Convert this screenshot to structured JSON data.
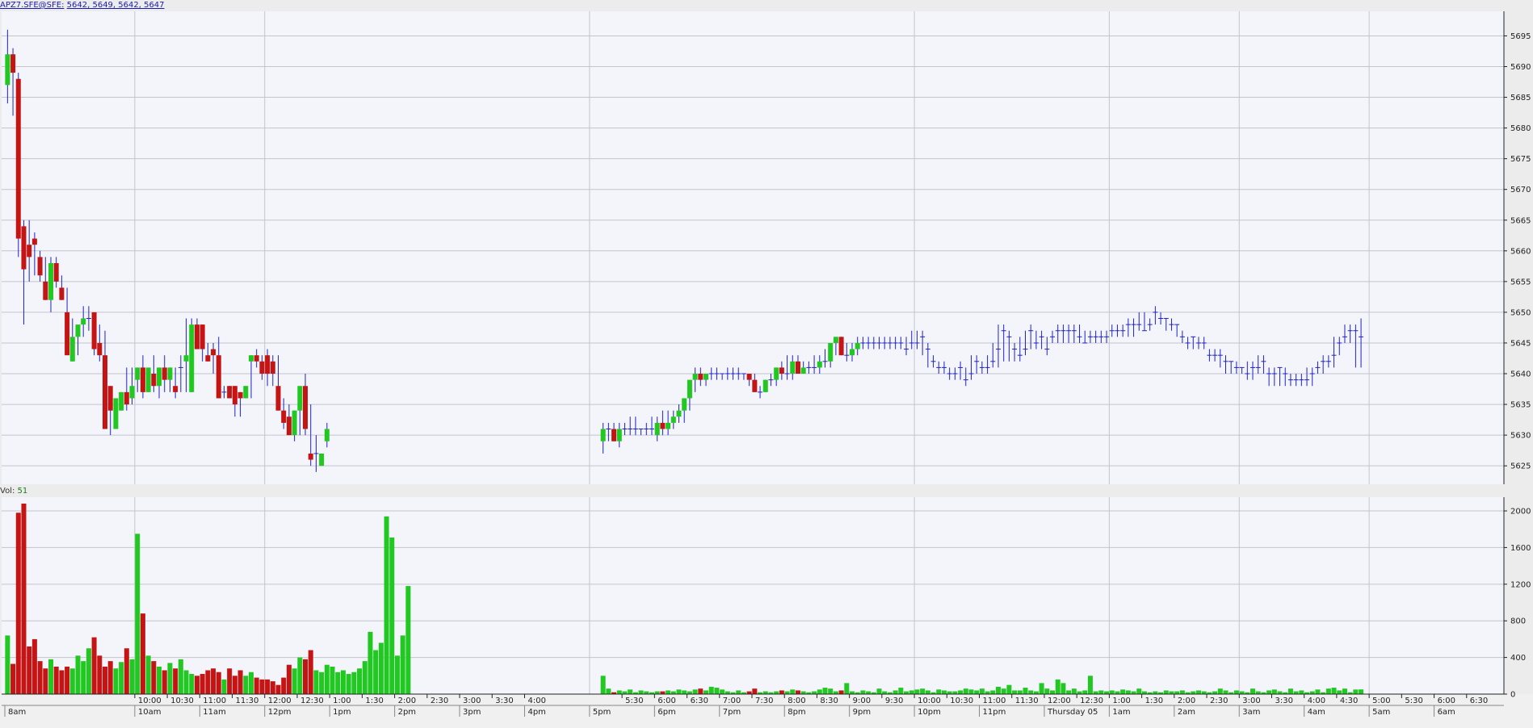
{
  "price_header": {
    "symbol": "APZ7.SFE@SFE:",
    "ohlc": "5642, 5649, 5642, 5647"
  },
  "volume_header": {
    "label": "Vol:",
    "value": "51"
  },
  "colors": {
    "up": "#22c822",
    "down": "#c41414",
    "doji": "#1e22c8",
    "grid": "#c4c4cc",
    "plot_bg": "#f4f4fb"
  },
  "chart_data": [
    {
      "type": "candlestick",
      "title": "APZ7.SFE@SFE",
      "interval_minutes": 5,
      "ylim": [
        5622,
        5699
      ],
      "yticks": [
        5625,
        5630,
        5635,
        5640,
        5645,
        5650,
        5655,
        5660,
        5665,
        5670,
        5675,
        5680,
        5685,
        5690,
        5695
      ],
      "grid": true,
      "legend": "none",
      "day_session": {
        "start_time": "8:00am",
        "end_time": "4:30pm",
        "open": [
          5687,
          5692,
          5688,
          5664,
          5661,
          5662,
          5659,
          5655,
          5652,
          5658,
          5654,
          5650,
          5642,
          5646,
          5648,
          5649,
          5650,
          5645,
          5643,
          5638,
          5631,
          5634,
          5637,
          5636,
          5639,
          5641,
          5637,
          5640,
          5638,
          5641,
          5639,
          5638,
          5641,
          5642,
          5637,
          5648,
          5648,
          5643,
          5644,
          5643,
          5637,
          5638,
          5638,
          5637,
          5636,
          5642,
          5643,
          5642,
          5643,
          5642,
          5638,
          5634,
          5633,
          5630,
          5634,
          5638,
          5627,
          5627,
          5625,
          5629
        ],
        "high": [
          5696,
          5693,
          5689,
          5665,
          5665,
          5663,
          5660,
          5659,
          5659,
          5659,
          5656,
          5654,
          5649,
          5647,
          5651,
          5651,
          5650,
          5648,
          5647,
          5638,
          5635,
          5637,
          5641,
          5641,
          5641,
          5643,
          5639,
          5643,
          5641,
          5643,
          5641,
          5641,
          5643,
          5649,
          5649,
          5649,
          5648,
          5645,
          5645,
          5646,
          5638,
          5638,
          5638,
          5637,
          5638,
          5643,
          5644,
          5643,
          5644,
          5643,
          5643,
          5636,
          5635,
          5634,
          5638,
          5640,
          5635,
          5630,
          5627,
          5632
        ],
        "low": [
          5684,
          5682,
          5659,
          5648,
          5655,
          5656,
          5655,
          5652,
          5650,
          5654,
          5652,
          5645,
          5642,
          5643,
          5646,
          5647,
          5643,
          5642,
          5636,
          5630,
          5631,
          5634,
          5634,
          5635,
          5637,
          5636,
          5637,
          5637,
          5636,
          5637,
          5637,
          5636,
          5637,
          5637,
          5637,
          5644,
          5642,
          5642,
          5640,
          5636,
          5636,
          5636,
          5633,
          5633,
          5636,
          5636,
          5641,
          5639,
          5638,
          5638,
          5634,
          5631,
          5630,
          5629,
          5630,
          5630,
          5625,
          5624,
          5625,
          5628
        ],
        "close": [
          5692,
          5689,
          5662,
          5657,
          5659,
          5661,
          5656,
          5652,
          5658,
          5655,
          5652,
          5643,
          5646,
          5648,
          5649,
          5649,
          5644,
          5643,
          5631,
          5634,
          5636,
          5637,
          5635,
          5638,
          5641,
          5637,
          5641,
          5638,
          5641,
          5639,
          5641,
          5637,
          5641,
          5643,
          5648,
          5644,
          5644,
          5642,
          5643,
          5636,
          5637,
          5636,
          5635,
          5636,
          5638,
          5643,
          5642,
          5640,
          5640,
          5640,
          5634,
          5632,
          5630,
          5634,
          5638,
          5631,
          5626,
          5627,
          5627,
          5631
        ]
      },
      "night_session": {
        "start_time": "5:10pm",
        "end_time": "6:55am",
        "open": [
          5629,
          5631,
          5631,
          5629,
          5631,
          5631,
          5631,
          5631,
          5631,
          5631,
          5630,
          5632,
          5631,
          5632,
          5633,
          5634,
          5636,
          5639,
          5640,
          5639,
          5640,
          5640,
          5640,
          5640,
          5640,
          5640,
          5640,
          5640,
          5639,
          5637,
          5637,
          5639,
          5639,
          5641,
          5640,
          5640,
          5642,
          5640,
          5641,
          5641,
          5641,
          5642,
          5642,
          5645,
          5646,
          5643,
          5643,
          5644,
          5645,
          5645,
          5645,
          5645,
          5645,
          5645,
          5645,
          5645,
          5644,
          5645,
          5645,
          5646,
          5644,
          5642,
          5641,
          5641,
          5640,
          5640,
          5641,
          5639,
          5640,
          5642,
          5641,
          5641,
          5642,
          5644,
          5647,
          5646,
          5644,
          5643,
          5644,
          5647,
          5645,
          5646,
          5644,
          5646,
          5647,
          5647,
          5647,
          5647,
          5646,
          5645,
          5646,
          5646,
          5646,
          5646,
          5647,
          5647,
          5647,
          5648,
          5648,
          5648,
          5647,
          5648,
          5650,
          5649,
          5649,
          5648,
          5648,
          5646,
          5645,
          5646,
          5645,
          5645,
          5643,
          5643,
          5643,
          5642,
          5642,
          5641,
          5641,
          5640,
          5641,
          5641,
          5642,
          5640,
          5640,
          5641,
          5640,
          5639,
          5639,
          5639,
          5639,
          5640,
          5641,
          5642,
          5642,
          5643,
          5645,
          5646,
          5647,
          5647,
          5646
        ],
        "high": [
          5632,
          5632,
          5632,
          5632,
          5632,
          5633,
          5633,
          5631,
          5632,
          5633,
          5633,
          5634,
          5634,
          5634,
          5635,
          5636,
          5638,
          5641,
          5641,
          5640,
          5641,
          5641,
          5640,
          5641,
          5641,
          5641,
          5640,
          5640,
          5640,
          5638,
          5639,
          5640,
          5641,
          5642,
          5643,
          5643,
          5643,
          5642,
          5642,
          5643,
          5643,
          5644,
          5645,
          5646,
          5646,
          5645,
          5645,
          5646,
          5646,
          5646,
          5646,
          5646,
          5646,
          5646,
          5646,
          5646,
          5646,
          5647,
          5647,
          5647,
          5645,
          5643,
          5642,
          5642,
          5641,
          5641,
          5642,
          5641,
          5643,
          5643,
          5642,
          5643,
          5645,
          5648,
          5648,
          5647,
          5645,
          5646,
          5647,
          5648,
          5647,
          5647,
          5646,
          5647,
          5648,
          5648,
          5648,
          5648,
          5648,
          5647,
          5647,
          5647,
          5647,
          5647,
          5648,
          5648,
          5648,
          5649,
          5649,
          5650,
          5650,
          5649,
          5651,
          5650,
          5649,
          5649,
          5648,
          5647,
          5646,
          5646,
          5646,
          5646,
          5644,
          5644,
          5644,
          5643,
          5642,
          5642,
          5641,
          5642,
          5642,
          5643,
          5643,
          5641,
          5641,
          5641,
          5641,
          5640,
          5640,
          5640,
          5641,
          5641,
          5642,
          5643,
          5643,
          5646,
          5646,
          5648,
          5648,
          5648,
          5649
        ],
        "low": [
          5627,
          5629,
          5629,
          5628,
          5630,
          5630,
          5630,
          5630,
          5630,
          5630,
          5629,
          5630,
          5630,
          5631,
          5632,
          5632,
          5634,
          5637,
          5638,
          5638,
          5639,
          5639,
          5639,
          5639,
          5639,
          5639,
          5639,
          5638,
          5637,
          5636,
          5637,
          5638,
          5638,
          5639,
          5639,
          5639,
          5640,
          5640,
          5640,
          5640,
          5640,
          5641,
          5641,
          5643,
          5643,
          5642,
          5642,
          5643,
          5644,
          5644,
          5644,
          5644,
          5644,
          5644,
          5644,
          5644,
          5643,
          5644,
          5644,
          5643,
          5641,
          5641,
          5640,
          5640,
          5639,
          5639,
          5639,
          5638,
          5639,
          5640,
          5640,
          5640,
          5641,
          5641,
          5642,
          5642,
          5642,
          5642,
          5643,
          5644,
          5644,
          5644,
          5643,
          5645,
          5645,
          5645,
          5645,
          5645,
          5645,
          5645,
          5645,
          5645,
          5645,
          5645,
          5646,
          5646,
          5646,
          5646,
          5646,
          5647,
          5647,
          5647,
          5648,
          5648,
          5647,
          5647,
          5646,
          5645,
          5644,
          5644,
          5644,
          5644,
          5642,
          5642,
          5641,
          5640,
          5640,
          5640,
          5640,
          5639,
          5639,
          5640,
          5640,
          5638,
          5638,
          5638,
          5638,
          5638,
          5638,
          5638,
          5638,
          5638,
          5640,
          5640,
          5641,
          5641,
          5643,
          5645,
          5645,
          5641,
          5641
        ],
        "close": [
          5631,
          5631,
          5629,
          5631,
          5631,
          5631,
          5631,
          5631,
          5631,
          5631,
          5632,
          5631,
          5632,
          5633,
          5634,
          5636,
          5639,
          5640,
          5639,
          5640,
          5640,
          5640,
          5640,
          5640,
          5640,
          5640,
          5640,
          5639,
          5637,
          5637,
          5639,
          5639,
          5641,
          5640,
          5640,
          5642,
          5640,
          5641,
          5641,
          5641,
          5642,
          5642,
          5645,
          5646,
          5643,
          5643,
          5644,
          5645,
          5645,
          5645,
          5645,
          5645,
          5645,
          5645,
          5645,
          5645,
          5644,
          5645,
          5645,
          5646,
          5644,
          5642,
          5641,
          5641,
          5640,
          5640,
          5641,
          5639,
          5640,
          5642,
          5641,
          5641,
          5642,
          5644,
          5647,
          5646,
          5644,
          5643,
          5644,
          5647,
          5645,
          5646,
          5644,
          5646,
          5647,
          5647,
          5647,
          5647,
          5646,
          5645,
          5646,
          5646,
          5646,
          5646,
          5647,
          5647,
          5647,
          5648,
          5648,
          5648,
          5647,
          5648,
          5650,
          5649,
          5649,
          5648,
          5648,
          5646,
          5645,
          5646,
          5645,
          5645,
          5643,
          5643,
          5643,
          5642,
          5642,
          5641,
          5641,
          5640,
          5641,
          5641,
          5642,
          5640,
          5640,
          5641,
          5640,
          5639,
          5639,
          5639,
          5639,
          5640,
          5641,
          5642,
          5642,
          5643,
          5645,
          5646,
          5647,
          5647,
          5646,
          5647
        ]
      }
    },
    {
      "type": "bar",
      "title": "Vol",
      "ylim": [
        0,
        2150
      ],
      "yticks": [
        0,
        400,
        800,
        1200,
        1600,
        2000
      ],
      "grid": true,
      "day_volume": [
        640,
        330,
        1980,
        2080,
        520,
        600,
        360,
        280,
        380,
        300,
        260,
        300,
        280,
        420,
        360,
        500,
        620,
        420,
        300,
        360,
        280,
        350,
        500,
        380,
        1750,
        880,
        420,
        360,
        300,
        260,
        340,
        280,
        380,
        260,
        220,
        200,
        220,
        260,
        280,
        240,
        160,
        280,
        200,
        260,
        200,
        240,
        180,
        160,
        160,
        140,
        100,
        180,
        320,
        280,
        400,
        380,
        480,
        260,
        240,
        320
      ],
      "day_volume_extra": [
        300,
        240,
        260,
        220,
        240,
        280,
        360,
        680,
        480,
        560,
        1940,
        1710,
        420,
        640,
        1180
      ],
      "night_volume": [
        200,
        60,
        20,
        40,
        30,
        50,
        20,
        40,
        30,
        20,
        30,
        30,
        40,
        30,
        50,
        40,
        30,
        50,
        60,
        40,
        80,
        70,
        50,
        30,
        20,
        40,
        20,
        30,
        60,
        20,
        30,
        20,
        30,
        40,
        30,
        50,
        40,
        30,
        20,
        30,
        50,
        70,
        60,
        30,
        40,
        120,
        30,
        20,
        40,
        30,
        20,
        60,
        30,
        20,
        40,
        70,
        30,
        40,
        50,
        60,
        40,
        20,
        50,
        40,
        30,
        30,
        40,
        60,
        50,
        40,
        60,
        30,
        40,
        80,
        60,
        100,
        40,
        40,
        70,
        40,
        30,
        120,
        60,
        40,
        160,
        120,
        40,
        60,
        30,
        40,
        200,
        30,
        40,
        30,
        40,
        30,
        50,
        40,
        30,
        60,
        30,
        20,
        30,
        20,
        40,
        30,
        30,
        40,
        20,
        30,
        40,
        30,
        20,
        30,
        60,
        40,
        20,
        40,
        30,
        20,
        60,
        30,
        20,
        40,
        50,
        30,
        20,
        60,
        30,
        40,
        20,
        30,
        50,
        20,
        60,
        70,
        40,
        60,
        20,
        50,
        51
      ]
    }
  ],
  "x_axis": {
    "top_labels": [
      "10:00",
      "10:30",
      "11:00",
      "11:30",
      "12:00",
      "12:30",
      "1:00",
      "1:30",
      "2:00",
      "2:30",
      "3:00",
      "3:30",
      "4:00",
      "5:30",
      "6:00",
      "6:30",
      "7:00",
      "7:30",
      "8:00",
      "8:30",
      "9:00",
      "9:30",
      "10:00",
      "10:30",
      "11:00",
      "11:30",
      "12:00",
      "12:30",
      "1:00",
      "1:30",
      "2:00",
      "2:30",
      "3:00",
      "3:30",
      "4:00",
      "4:30",
      "5:00",
      "5:30",
      "6:00",
      "6:30"
    ],
    "bottom_labels": [
      "8am",
      "10am",
      "11am",
      "12pm",
      "1pm",
      "2pm",
      "3pm",
      "4pm",
      "5pm",
      "6pm",
      "7pm",
      "8pm",
      "9pm",
      "10pm",
      "11pm",
      "Thursday 05",
      "1am",
      "2am",
      "3am",
      "4am",
      "5am",
      "6am"
    ]
  }
}
